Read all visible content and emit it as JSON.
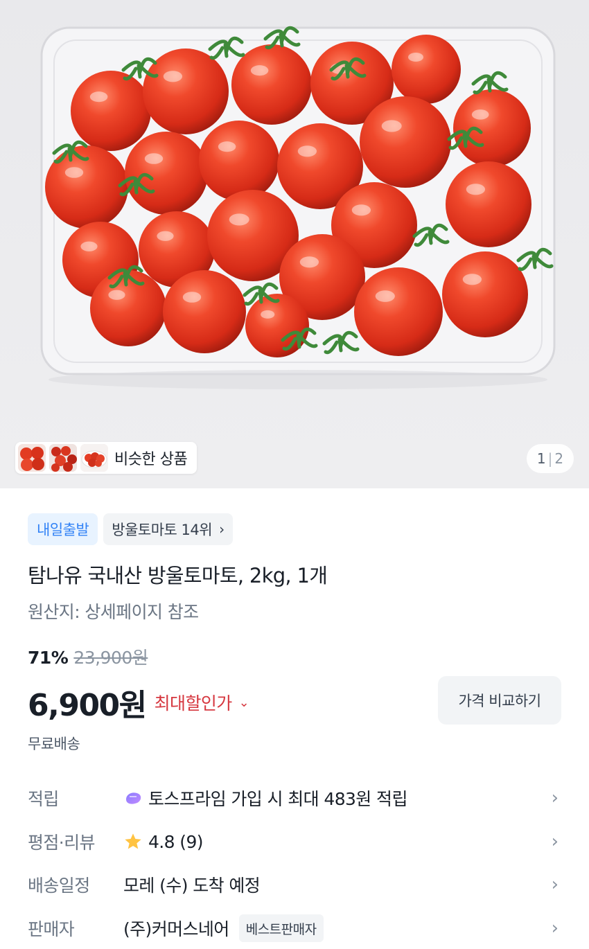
{
  "hero": {
    "similar_products_label": "비슷한 상품",
    "pager_current": "1",
    "pager_separator": "|",
    "pager_total": "2"
  },
  "tags": {
    "departure": "내일출발",
    "ranking": "방울토마토 14위"
  },
  "product": {
    "title": "탐나유 국내산 방울토마토, 2kg, 1개",
    "origin": "원산지: 상세페이지 참조",
    "discount_rate": "71%",
    "original_price": "23,900원",
    "price": "6,900원",
    "max_discount_label": "최대할인가",
    "compare_button": "가격 비교하기",
    "shipping": "무료배송"
  },
  "details": {
    "points_label": "적립",
    "points_value": "토스프라임 가입 시 최대 483원 적립",
    "rating_label": "평점·리뷰",
    "rating_value": "4.8 (9)",
    "delivery_label": "배송일정",
    "delivery_value": "모레 (수) 도착 예정",
    "seller_label": "판매자",
    "seller_value": "(주)커머스네어",
    "seller_badge": "베스트판매자"
  },
  "colors": {
    "accent_blue": "#3182f6",
    "discount_red": "#d6373f",
    "star_yellow": "#ffc342"
  },
  "icons": {
    "ranking_chevron": "chevron-right-icon",
    "max_discount_chevron": "chevron-down-icon",
    "points": "toss-prime-icon",
    "rating": "star-icon",
    "row_chevron": "chevron-right-icon"
  }
}
